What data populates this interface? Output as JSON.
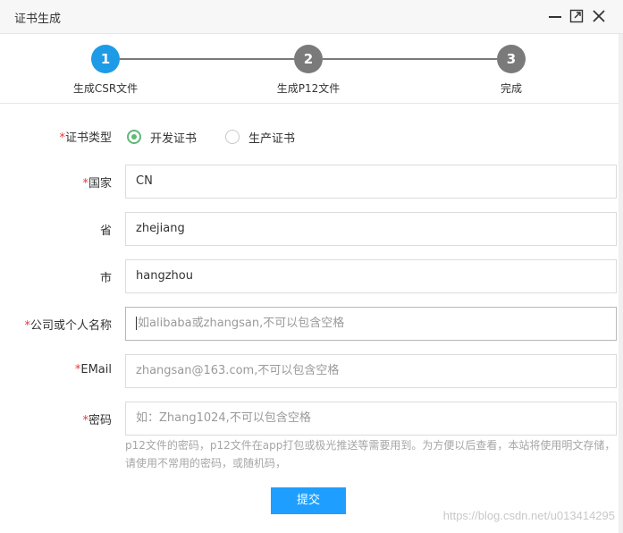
{
  "window": {
    "title": "证书生成"
  },
  "steps": [
    {
      "number": "1",
      "label": "生成CSR文件",
      "state": "active"
    },
    {
      "number": "2",
      "label": "生成P12文件",
      "state": "pending"
    },
    {
      "number": "3",
      "label": "完成",
      "state": "pending"
    }
  ],
  "form": {
    "required_mark": "*",
    "cert_type": {
      "label": "证书类型",
      "options": [
        "开发证书",
        "生产证书"
      ],
      "selected": "开发证书"
    },
    "country": {
      "label": "国家",
      "value": "CN"
    },
    "province": {
      "label": "省",
      "value": "zhejiang"
    },
    "city": {
      "label": "市",
      "value": "hangzhou"
    },
    "org_name": {
      "label": "公司或个人名称",
      "value": "",
      "placeholder": "如alibaba或zhangsan,不可以包含空格"
    },
    "email": {
      "label": "EMail",
      "value": "",
      "placeholder": "zhangsan@163.com,不可以包含空格"
    },
    "password": {
      "label": "密码",
      "value": "",
      "placeholder": "如：Zhang1024,不可以包含空格"
    },
    "password_hint": "p12文件的密码，p12文件在app打包或极光推送等需要用到。为方便以后查看，本站将使用明文存储，请使用不常用的密码，或随机码，",
    "submit_label": "提交"
  },
  "watermark": "https://blog.csdn.net/u013414295",
  "colors": {
    "accent": "#1e9fff",
    "step_active": "#1e9be6",
    "step_inactive": "#7a7a7a",
    "radio_checked": "#5fb878",
    "required": "#e4393c"
  }
}
